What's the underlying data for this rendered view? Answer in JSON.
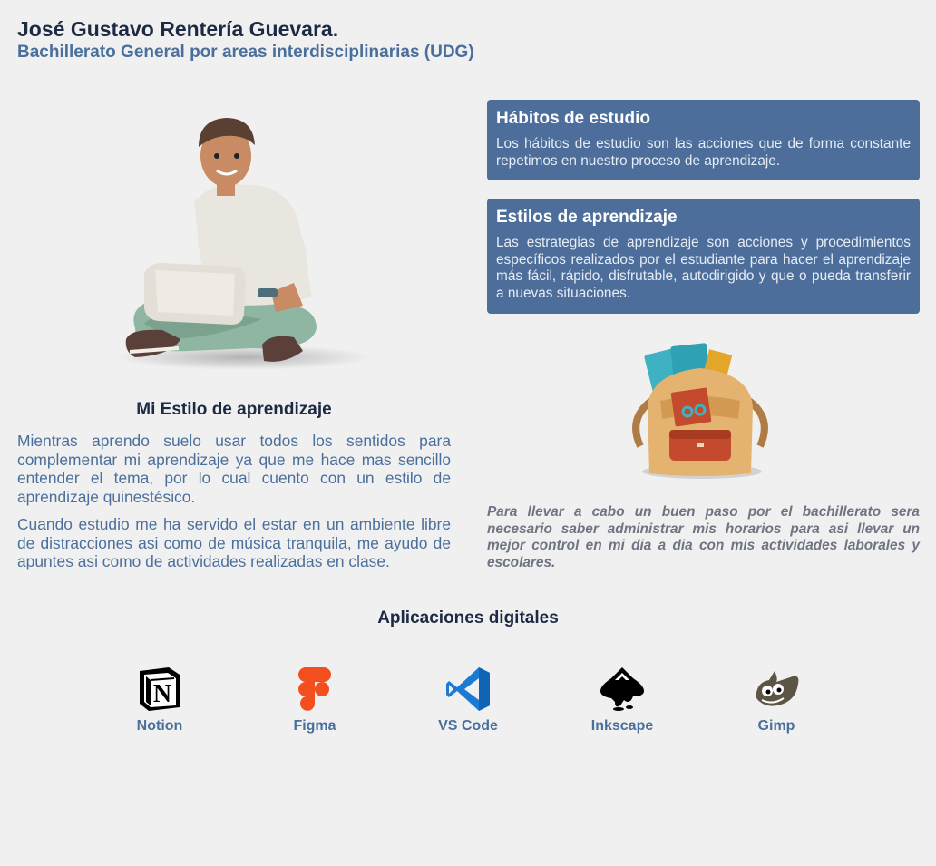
{
  "header": {
    "name": "José Gustavo Rentería Guevara.",
    "program": "Bachillerato General por areas interdisciplinarias (UDG)"
  },
  "left": {
    "hero_icon": "student-with-laptop-illustration",
    "title": "Mi Estilo de aprendizaje",
    "paragraph1": "Mientras aprendo suelo usar todos los sentidos para complementar mi aprendizaje ya que me hace mas sencillo entender el tema, por lo cual cuento con un estilo de aprendizaje quinestésico.",
    "paragraph2": "Cuando estudio me ha servido el estar en un ambiente libre de distracciones asi como de música tranquila, me ayudo de apuntes asi como de actividades realizadas en clase."
  },
  "cards": [
    {
      "title": "Hábitos de estudio",
      "text": "Los hábitos de estudio son las acciones que de forma constante repetimos en nuestro proceso de aprendizaje."
    },
    {
      "title": "Estilos de aprendizaje",
      "text": "Las estrategias de aprendizaje son acciones y procedimientos específicos realizados por el estudiante para hacer el aprendizaje más fácil, rápido, disfrutable, autodirigido y que o pueda transferir a nuevas situaciones."
    }
  ],
  "right": {
    "backpack_icon": "backpack-illustration",
    "quote": "Para llevar a cabo un buen paso por el bachillerato sera necesario saber administrar mis horarios para asi llevar un mejor control en mi dia a dia con mis actividades laborales y escolares."
  },
  "apps": {
    "title": "Aplicaciones digitales",
    "items": [
      {
        "label": "Notion",
        "icon": "notion-icon"
      },
      {
        "label": "Figma",
        "icon": "figma-icon"
      },
      {
        "label": "VS Code",
        "icon": "vscode-icon"
      },
      {
        "label": "Inkscape",
        "icon": "inkscape-icon"
      },
      {
        "label": "Gimp",
        "icon": "gimp-icon"
      }
    ]
  },
  "colors": {
    "background": "#f0f0f0",
    "heading": "#1d2a44",
    "accent": "#4b6f9c",
    "card": "#4d6e9b",
    "quote": "#6e7482"
  }
}
